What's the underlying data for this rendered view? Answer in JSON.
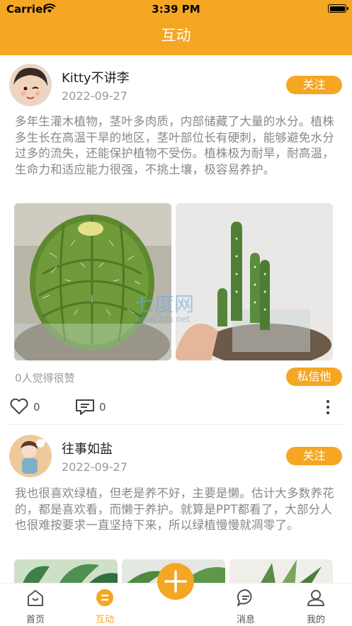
{
  "status_bar": {
    "carrier": "Carrier",
    "time": "3:39 PM"
  },
  "header": {
    "title": "互动"
  },
  "posts": [
    {
      "username": "Kitty不讲李",
      "date": "2022-09-27",
      "follow_label": "关注",
      "text": "多年生灌木植物，茎叶多肉质，内部储藏了大量的水分。植株多生长在高温干旱的地区，茎叶部位长有硬刺，能够避免水分过多的流失，还能保护植物不受伤。植株极为耐旱，耐高温，生命力和适应能力很强，不挑土壤，极容易养护。",
      "likes_text": "0人觉得很赞",
      "pm_label": "私信他",
      "like_count": "0",
      "comment_count": "0"
    },
    {
      "username": "往事如盐",
      "date": "2022-09-27",
      "follow_label": "关注",
      "text": "我也很喜欢绿植，但老是养不好，主要是懒。估计大多数养花的，都是喜欢看，而懒于养护。就算是PPT都看了，大部分人也很难按要求一直坚持下来，所以绿植慢慢就凋零了。"
    }
  ],
  "watermark": {
    "text": "七度网",
    "sub": "www.7do.net"
  },
  "tabbar": {
    "items": [
      {
        "label": "首页",
        "icon": "home-icon"
      },
      {
        "label": "互动",
        "icon": "interact-icon"
      },
      {
        "label": "消息",
        "icon": "message-icon"
      },
      {
        "label": "我的",
        "icon": "profile-icon"
      }
    ],
    "center_icon": "plus-icon"
  },
  "colors": {
    "accent": "#F5A623",
    "text_gray": "#888888"
  }
}
